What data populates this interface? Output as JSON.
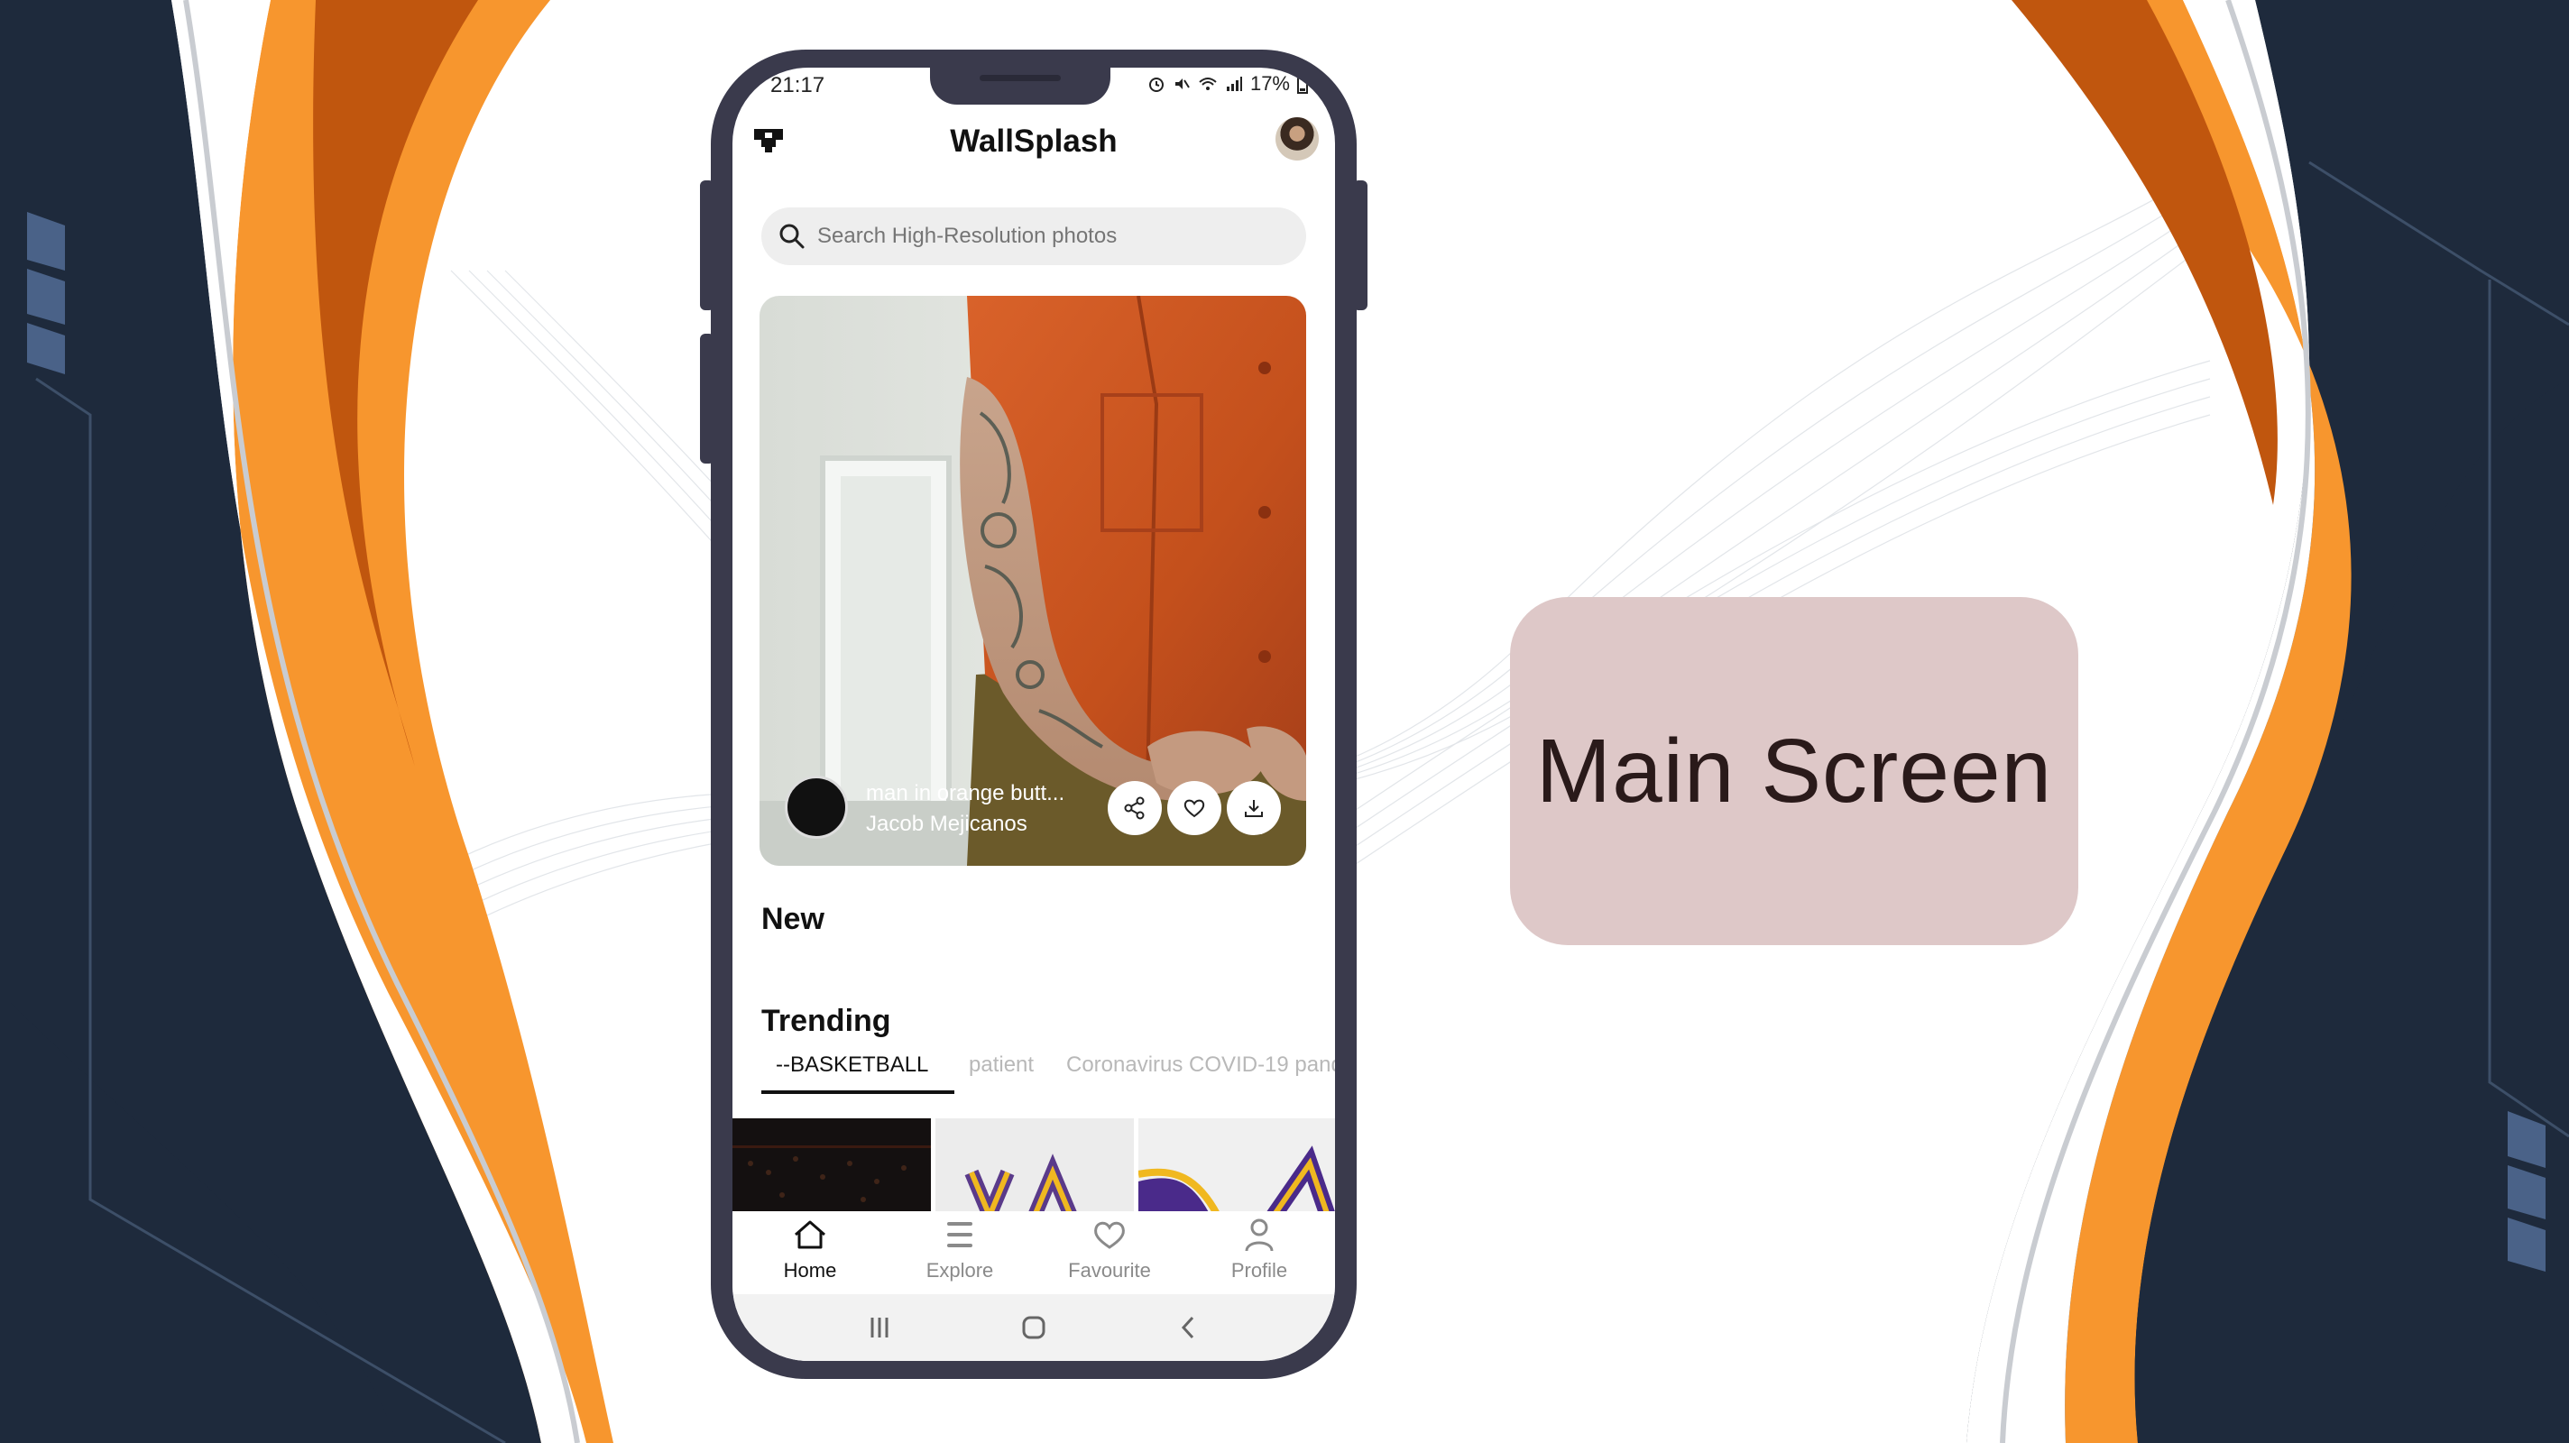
{
  "slide": {
    "label": "Main Screen"
  },
  "phone": {
    "status": {
      "time": "21:17",
      "battery": "17%"
    },
    "app": {
      "title": "WallSplash",
      "logo": "wallsplash-logo",
      "avatar": "profile-avatar"
    },
    "search": {
      "placeholder": "Search High-Resolution photos",
      "icon": "search-icon"
    },
    "hero": {
      "title": "man in orange butt...",
      "author": "Jacob Mejicanos",
      "actions": [
        {
          "name": "share-icon"
        },
        {
          "name": "heart-icon"
        },
        {
          "name": "download-icon"
        }
      ]
    },
    "sections": {
      "new": "New",
      "trending": "Trending"
    },
    "tabs": [
      {
        "label": "--BASKETBALL",
        "active": true
      },
      {
        "label": "patient",
        "active": false
      },
      {
        "label": "Coronavirus COVID-19 pand",
        "active": false
      }
    ],
    "bottom_nav": [
      {
        "label": "Home",
        "icon": "home-icon",
        "active": true
      },
      {
        "label": "Explore",
        "icon": "explore-icon",
        "active": false
      },
      {
        "label": "Favourite",
        "icon": "heart-icon",
        "active": false
      },
      {
        "label": "Profile",
        "icon": "person-icon",
        "active": false
      }
    ],
    "system_nav": [
      "recent-apps-icon",
      "home-circle-icon",
      "back-icon"
    ]
  },
  "colors": {
    "navy": "#1e2a3c",
    "orange": "#f7962e",
    "dark_orange": "#c0560e",
    "phone_frame": "#3a3a4c",
    "card": "#dec8c8"
  }
}
